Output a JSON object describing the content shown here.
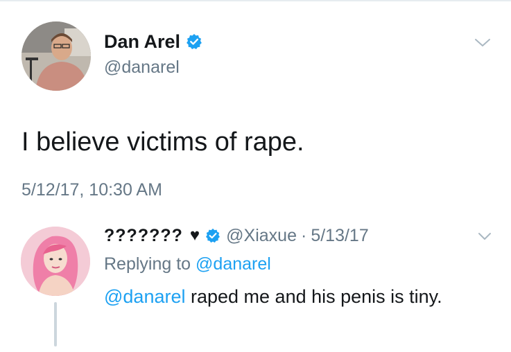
{
  "main_tweet": {
    "author_name": "Dan Arel",
    "author_handle": "@danarel",
    "text": "I believe victims of rape.",
    "timestamp": "5/12/17, 10:30 AM",
    "verified_icon": "verified-badge-icon",
    "menu_icon": "chevron-down-icon"
  },
  "reply": {
    "author_name": "???????",
    "heart": "♥",
    "verified_icon": "verified-badge-icon",
    "author_handle": "@Xiaxue",
    "separator": "·",
    "date": "5/13/17",
    "replying_prefix": "Replying to",
    "replying_to": "@danarel",
    "mention": "@danarel",
    "text_body": " raped me and his penis is tiny.",
    "menu_icon": "chevron-down-icon"
  },
  "colors": {
    "text": "#14171a",
    "muted": "#657786",
    "link": "#1da1f2",
    "verified": "#1da1f2",
    "thread_line": "#ccd6dd"
  }
}
